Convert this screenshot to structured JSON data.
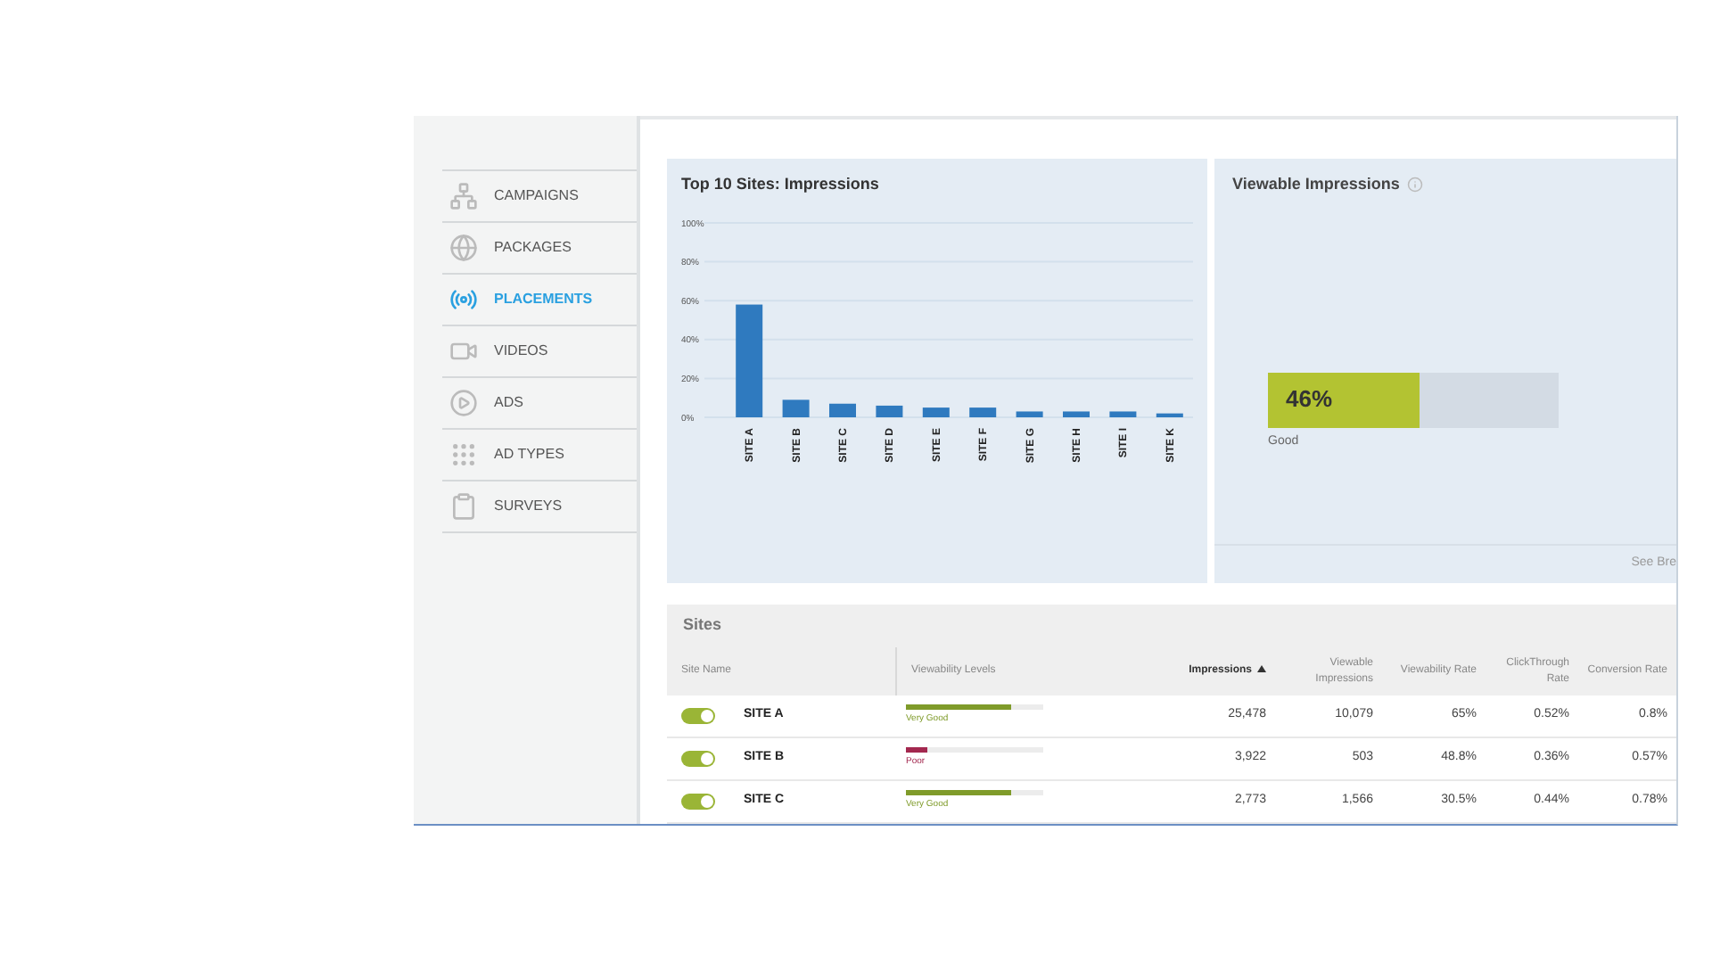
{
  "sidebar": {
    "items": [
      {
        "label": "CAMPAIGNS",
        "selected": false
      },
      {
        "label": "PACKAGES",
        "selected": false
      },
      {
        "label": "PLACEMENTS",
        "selected": true
      },
      {
        "label": "VIDEOS",
        "selected": false
      },
      {
        "label": "ADS",
        "selected": false
      },
      {
        "label": "AD TYPES",
        "selected": false
      },
      {
        "label": "SURVEYS",
        "selected": false
      }
    ]
  },
  "top_sites": {
    "title": "Top 10 Sites: Impressions",
    "chart_data": {
      "type": "bar",
      "categories": [
        "SITE A",
        "SITE B",
        "SITE C",
        "SITE D",
        "SITE E",
        "SITE F",
        "SITE G",
        "SITE H",
        "SITE I",
        "SITE K"
      ],
      "values": [
        58,
        9,
        7,
        6,
        5,
        5,
        3,
        3,
        3,
        2
      ],
      "ylim": [
        0,
        100
      ],
      "grid": true,
      "yticks": [
        {
          "value": 0,
          "label": "0%"
        },
        {
          "value": 20,
          "label": "20%"
        },
        {
          "value": 40,
          "label": "40%"
        },
        {
          "value": 60,
          "label": "60%"
        },
        {
          "value": 80,
          "label": "80%"
        },
        {
          "value": 100,
          "label": "100%"
        }
      ]
    }
  },
  "viewable": {
    "title": "Viewable Impressions",
    "value": "46%",
    "level": 0.52,
    "rating": "Good",
    "link": "See Bre"
  },
  "sites": {
    "title": "Sites",
    "columns": [
      {
        "label": "Site Name",
        "sorted": false
      },
      {
        "label": "Viewability Levels",
        "sorted": false
      },
      {
        "label": "Impressions",
        "sorted": true
      },
      {
        "label": "Viewable Impressions",
        "sorted": false
      },
      {
        "label": "Viewability Rate",
        "sorted": false
      },
      {
        "label": "ClickThrough Rate",
        "sorted": false
      },
      {
        "label": "Conversion Rate",
        "sorted": false
      }
    ],
    "rows": [
      {
        "on": true,
        "site_name": "SITE A",
        "viewability": {
          "level": 0.77,
          "color": "#7f9b2a",
          "rating": "Very Good"
        },
        "impressions": "25,478",
        "viewable_impressions": "10,079",
        "viewability_rate": "65%",
        "clickthrough_rate": "0.52%",
        "conversion_rate": "0.8%"
      },
      {
        "on": true,
        "site_name": "SITE B",
        "viewability": {
          "level": 0.15,
          "color": "#a3284f",
          "rating": "Poor"
        },
        "impressions": "3,922",
        "viewable_impressions": "503",
        "viewability_rate": "48.8%",
        "clickthrough_rate": "0.36%",
        "conversion_rate": "0.57%"
      },
      {
        "on": true,
        "site_name": "SITE C",
        "viewability": {
          "level": 0.77,
          "color": "#7f9b2a",
          "rating": "Very Good"
        },
        "impressions": "2,773",
        "viewable_impressions": "1,566",
        "viewability_rate": "30.5%",
        "clickthrough_rate": "0.44%",
        "conversion_rate": "0.78%"
      }
    ]
  }
}
